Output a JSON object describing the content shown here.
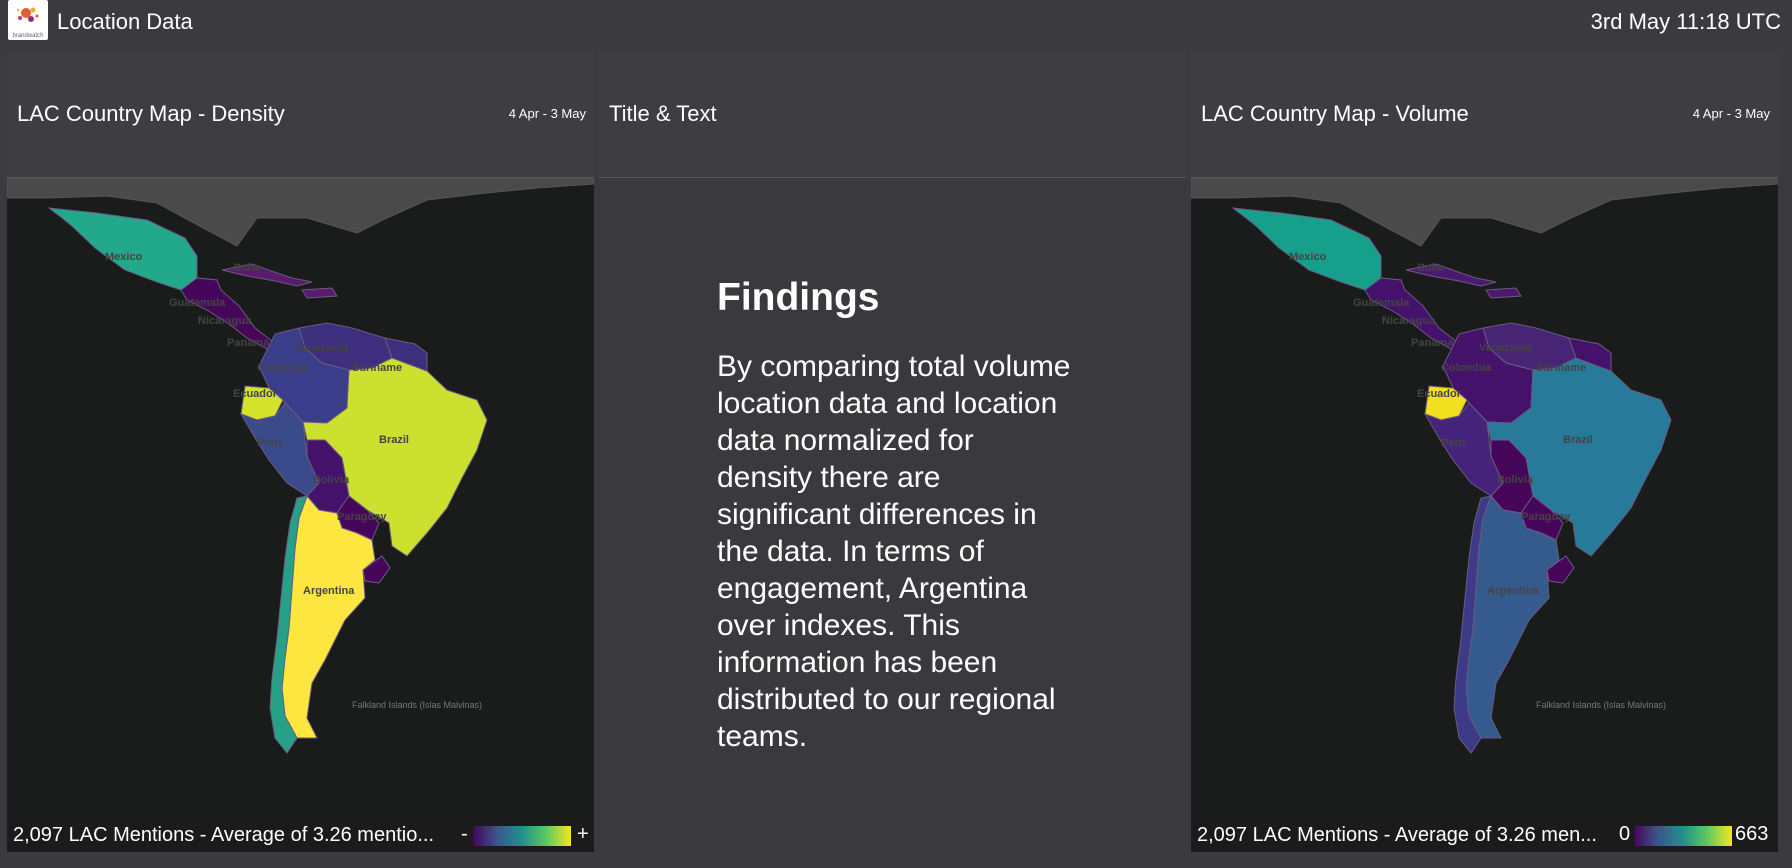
{
  "header": {
    "app_title": "Location Data",
    "clock": "3rd May 11:18 UTC",
    "logo_text": "brandwatch"
  },
  "panels": {
    "density": {
      "title": "LAC Country Map - Density",
      "date_range": "4 Apr - 3 May",
      "footer": "2,097 LAC Mentions - Average of 3.26 mentio...",
      "legend_min": "-",
      "legend_max": "+"
    },
    "text": {
      "title": "Title & Text",
      "heading": "Findings",
      "body": "By comparing total volume location data and location data normalized for density there are significant differences in the data. In terms of engagement, Argentina over indexes. This information has been distributed to our regional teams."
    },
    "volume": {
      "title": "LAC Country Map - Volume",
      "date_range": "4 Apr - 3 May",
      "footer": "2,097 LAC Mentions - Average of 3.26 men...",
      "legend_min": "0",
      "legend_max": "663"
    }
  },
  "map_labels": {
    "mexico": "Mexico",
    "cuba": "Cuba",
    "guatemala": "Guatemala",
    "nicaragua": "Nicaragua",
    "panama": "Panama",
    "venezuela": "Venezuela",
    "suriname": "Suriname",
    "colombia": "Colombia",
    "ecuador": "Ecuador",
    "brazil": "Brazil",
    "peru": "Peru",
    "bolivia": "Bolivia",
    "paraguay": "Paraguay",
    "argentina": "Argentina",
    "falkland": "Falkland Islands (Islas Malvinas)"
  },
  "color_scale": [
    "#46065a",
    "#3a568c",
    "#21908d",
    "#5dc962",
    "#f6e620"
  ],
  "map_colors": {
    "density": {
      "mexico": "#22a88a",
      "central": "#46065a",
      "caribbean": "#5a1a6e",
      "venezuela": "#3d2f7e",
      "colombia": "#3a3e8a",
      "ecuador": "#d3e22a",
      "peru": "#3b4a8b",
      "bolivia": "#44126b",
      "brazil": "#cce030",
      "guyanas": "#3d2f7e",
      "paraguay": "#46065a",
      "uruguay": "#46065a",
      "argentina": "#fde640",
      "chile": "#27a088"
    },
    "volume": {
      "mexico": "#169f8a",
      "central": "#44126b",
      "caribbean": "#4a1a6e",
      "venezuela": "#482475",
      "colombia": "#44126b",
      "ecuador": "#f0e020",
      "peru": "#45237a",
      "bolivia": "#46065a",
      "brazil": "#287a9a",
      "guyanas": "#44126b",
      "paraguay": "#46065a",
      "uruguay": "#46065a",
      "argentina": "#355a8e",
      "chile": "#3d3a88"
    }
  }
}
